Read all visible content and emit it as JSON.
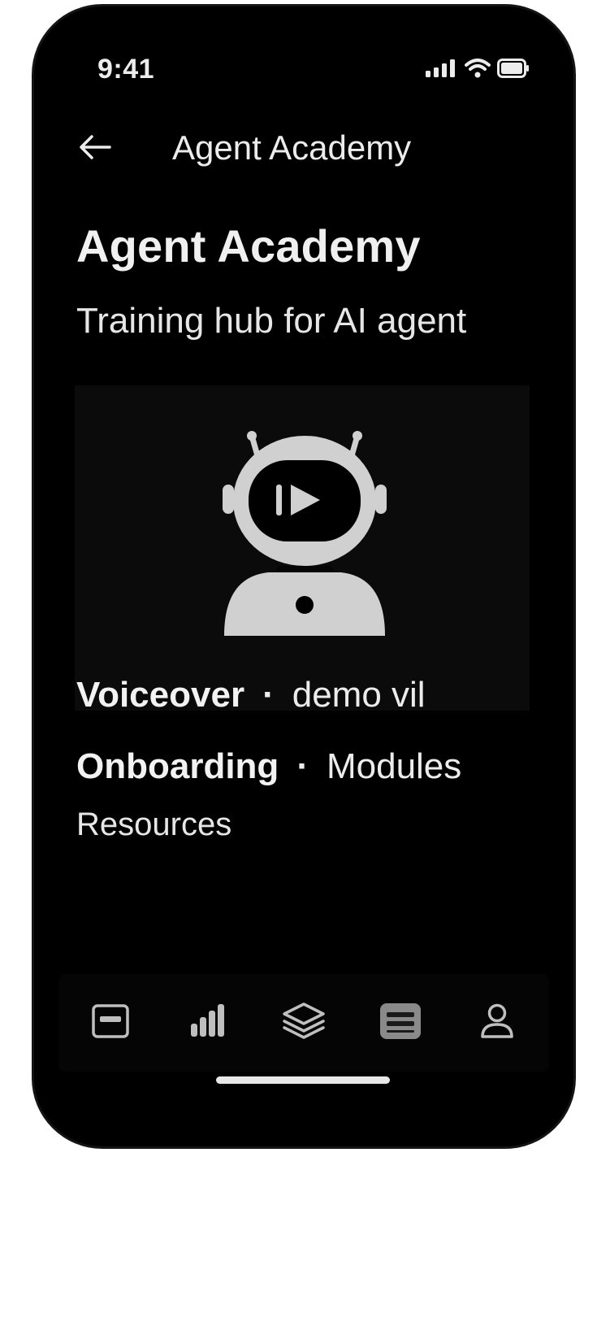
{
  "status_bar": {
    "time": "9:41",
    "icons": [
      "signal-icon",
      "wifi-icon",
      "battery-icon"
    ]
  },
  "nav": {
    "back_icon": "arrow-left-icon",
    "title": "Agent Academy"
  },
  "header": {
    "title": "Agent Academy",
    "subtitle": "Training hub for AI agent"
  },
  "hero": {
    "icon": "robot-play-icon"
  },
  "rows": {
    "row1_strong": "Voiceover",
    "row1_separator": "·",
    "row1_text": "demo vil",
    "row2_strong": "Onboarding",
    "row2_separator": "·",
    "row2_text": "Modules",
    "row3_text": "Resources"
  },
  "tab_bar": {
    "items": [
      {
        "icon": "dashboard-icon"
      },
      {
        "icon": "bar-chart-icon"
      },
      {
        "icon": "layers-icon"
      },
      {
        "icon": "list-icon",
        "active": true
      },
      {
        "icon": "profile-icon"
      }
    ]
  },
  "colors": {
    "background": "#000000",
    "text": "#ececec",
    "icon": "#bfbfbf",
    "hero_bg": "#0b0b0b"
  }
}
